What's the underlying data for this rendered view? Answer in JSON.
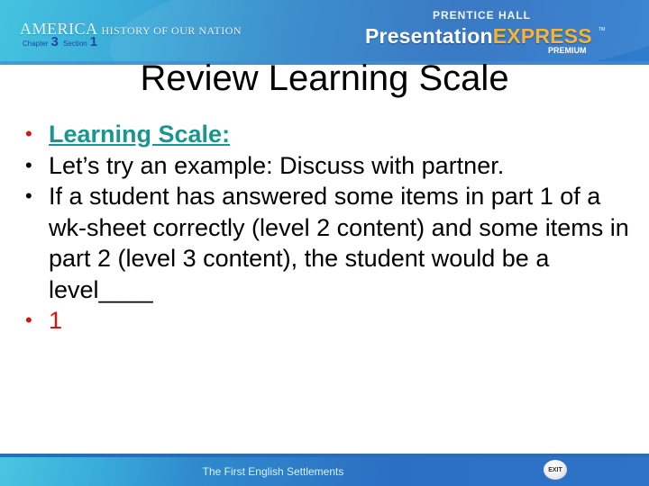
{
  "header": {
    "brand_main": "AMERICA",
    "brand_sub": "HISTORY OF OUR NATION",
    "chapter_label": "Chapter",
    "chapter_num": "3",
    "section_label": "Section",
    "section_num": "1",
    "publisher": "PRENTICE HALL",
    "product_a": "Presentation",
    "product_b": "EXPRESS",
    "trademark": "TM",
    "edition": "PREMIUM"
  },
  "slide": {
    "title": "Review Learning Scale",
    "bullets": [
      {
        "text": "Learning Scale:",
        "style": "teal-underlined"
      },
      {
        "text": "Let’s try an example: Discuss with partner.",
        "style": "normal"
      },
      {
        "text": "If a student has answered some items in part 1 of a wk-sheet correctly (level 2 content) and some items in part 2 (level 3 content), the student would be a level____",
        "style": "normal"
      },
      {
        "text": "1",
        "style": "red"
      }
    ],
    "bullet_glyph": "•"
  },
  "footer": {
    "section_title": "The First English Settlements",
    "exit_label": "EXIT"
  },
  "colors": {
    "accent_teal": "#1a9690",
    "accent_red": "#e01010",
    "header_blue": "#2c6fc0",
    "express_gold": "#f4b43a"
  }
}
